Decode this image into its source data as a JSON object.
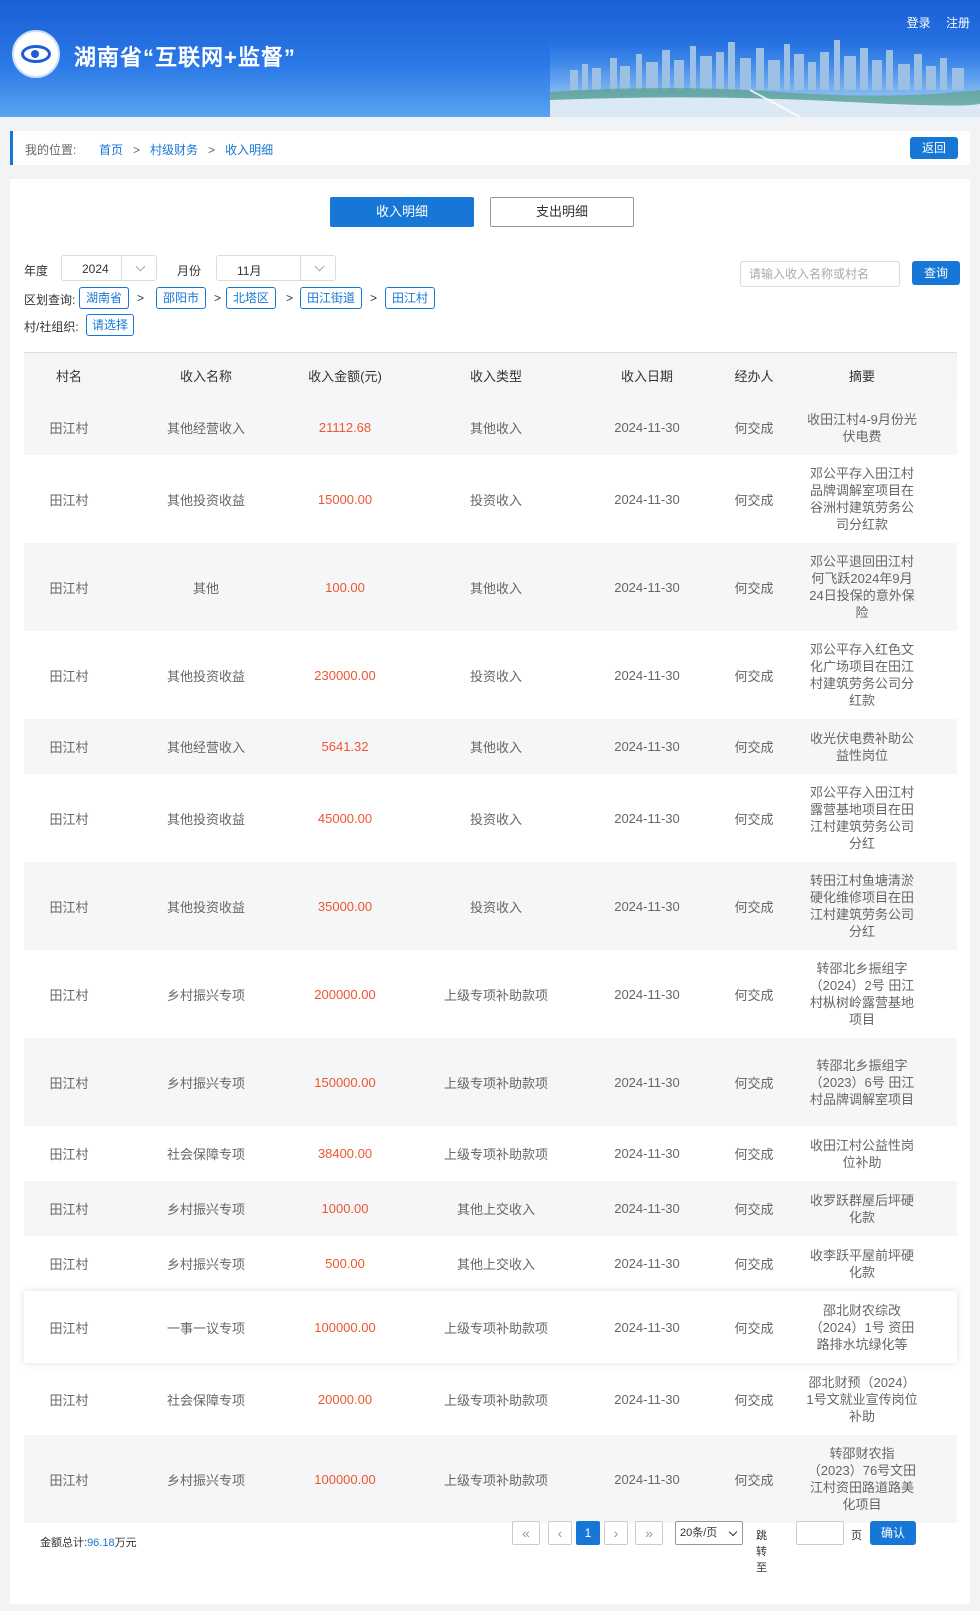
{
  "header": {
    "site_title": "湖南省“互联网+监督”",
    "login": "登录",
    "register": "注册"
  },
  "breadcrumb": {
    "label": "我的位置:",
    "items": [
      "首页",
      "村级财务",
      "收入明细"
    ],
    "separator": ">",
    "back_label": "返回"
  },
  "tabs": [
    {
      "label": "收入明细",
      "active": true
    },
    {
      "label": "支出明细",
      "active": false
    }
  ],
  "filters": {
    "year_label": "年度",
    "year_value": "2024",
    "month_label": "月份",
    "month_value": "11月",
    "search_placeholder": "请输入收入名称或村名",
    "query_label": "查询",
    "region_label": "区划查询:",
    "regions": [
      "湖南省",
      "邵阳市",
      "北塔区",
      "田江街道",
      "田江村"
    ],
    "region_sep": ">",
    "org_label": "村/社组织:",
    "org_value": "请选择"
  },
  "table": {
    "columns": [
      "村名",
      "收入名称",
      "收入金额(元)",
      "收入类型",
      "收入日期",
      "经办人",
      "摘要"
    ],
    "rows": [
      {
        "village": "田江村",
        "name": "其他经营收入",
        "amount": "21112.68",
        "type": "其他收入",
        "date": "2024-11-30",
        "handler": "何交成",
        "memo": "收田江村4-9月份光伏电费"
      },
      {
        "village": "田江村",
        "name": "其他投资收益",
        "amount": "15000.00",
        "type": "投资收入",
        "date": "2024-11-30",
        "handler": "何交成",
        "memo": "邓公平存入田江村品牌调解室项目在谷洲村建筑劳务公司分红款"
      },
      {
        "village": "田江村",
        "name": "其他",
        "amount": "100.00",
        "type": "其他收入",
        "date": "2024-11-30",
        "handler": "何交成",
        "memo": "邓公平退回田江村何飞跃2024年9月24日投保的意外保险"
      },
      {
        "village": "田江村",
        "name": "其他投资收益",
        "amount": "230000.00",
        "type": "投资收入",
        "date": "2024-11-30",
        "handler": "何交成",
        "memo": "邓公平存入红色文化广场项目在田江村建筑劳务公司分红款"
      },
      {
        "village": "田江村",
        "name": "其他经营收入",
        "amount": "5641.32",
        "type": "其他收入",
        "date": "2024-11-30",
        "handler": "何交成",
        "memo": "收光伏电费补助公益性岗位"
      },
      {
        "village": "田江村",
        "name": "其他投资收益",
        "amount": "45000.00",
        "type": "投资收入",
        "date": "2024-11-30",
        "handler": "何交成",
        "memo": "邓公平存入田江村露营基地项目在田江村建筑劳务公司分红"
      },
      {
        "village": "田江村",
        "name": "其他投资收益",
        "amount": "35000.00",
        "type": "投资收入",
        "date": "2024-11-30",
        "handler": "何交成",
        "memo": "转田江村鱼塘清淤硬化维修项目在田江村建筑劳务公司分红"
      },
      {
        "village": "田江村",
        "name": "乡村振兴专项",
        "amount": "200000.00",
        "type": "上级专项补助款项",
        "date": "2024-11-30",
        "handler": "何交成",
        "memo": "转邵北乡振组字（2024）2号 田江村枞树岭露营基地项目"
      },
      {
        "village": "田江村",
        "name": "乡村振兴专项",
        "amount": "150000.00",
        "type": "上级专项补助款项",
        "date": "2024-11-30",
        "handler": "何交成",
        "memo": "转邵北乡振组字（2023）6号 田江村品牌调解室项目"
      },
      {
        "village": "田江村",
        "name": "社会保障专项",
        "amount": "38400.00",
        "type": "上级专项补助款项",
        "date": "2024-11-30",
        "handler": "何交成",
        "memo": "收田江村公益性岗位补助"
      },
      {
        "village": "田江村",
        "name": "乡村振兴专项",
        "amount": "1000.00",
        "type": "其他上交收入",
        "date": "2024-11-30",
        "handler": "何交成",
        "memo": "收罗跃群屋后坪硬化款"
      },
      {
        "village": "田江村",
        "name": "乡村振兴专项",
        "amount": "500.00",
        "type": "其他上交收入",
        "date": "2024-11-30",
        "handler": "何交成",
        "memo": "收李跃平屋前坪硬化款"
      },
      {
        "village": "田江村",
        "name": "一事一议专项",
        "amount": "100000.00",
        "type": "上级专项补助款项",
        "date": "2024-11-30",
        "handler": "何交成",
        "memo": "邵北财农综改（2024）1号 资田路排水坑绿化等"
      },
      {
        "village": "田江村",
        "name": "社会保障专项",
        "amount": "20000.00",
        "type": "上级专项补助款项",
        "date": "2024-11-30",
        "handler": "何交成",
        "memo": "邵北财预（2024）1号文就业宣传岗位补助"
      },
      {
        "village": "田江村",
        "name": "乡村振兴专项",
        "amount": "100000.00",
        "type": "上级专项补助款项",
        "date": "2024-11-30",
        "handler": "何交成",
        "memo": "转邵财农指（2023）76号文田江村资田路道路美化项目"
      }
    ]
  },
  "footer": {
    "total_label": "金额总计:",
    "total_value": "96.18",
    "total_unit": "万元",
    "current_page": "1",
    "page_size": "20条/页",
    "jump_label": "跳转至",
    "page_unit": "页",
    "confirm_label": "确认"
  }
}
